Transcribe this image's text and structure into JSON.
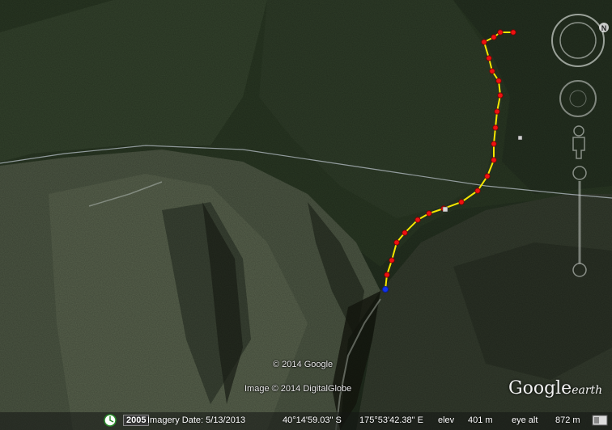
{
  "app": "Google Earth",
  "map": {
    "credits": [
      "© 2014 Google",
      "Image © 2014 DigitalGlobe"
    ],
    "logo_main": "Google",
    "logo_sub": "earth"
  },
  "navigation": {
    "compass_label": "N"
  },
  "statusbar": {
    "imagery_year": "2005",
    "imagery_date": "Imagery Date: 5/13/2013",
    "latitude": "40°14'59.03\" S",
    "longitude": "175°53'42.38\" E",
    "elev_label": "elev",
    "elev_value": "401 m",
    "eye_alt_label": "eye alt",
    "eye_alt_value": "872 m"
  },
  "track": {
    "line_color": "#f5e600",
    "waypoint_color": "#ee1111",
    "start_color": "#1133ee"
  },
  "colors": {
    "forest": "#26321f",
    "grass": "#4f5a45",
    "road": "#c8cccf"
  }
}
